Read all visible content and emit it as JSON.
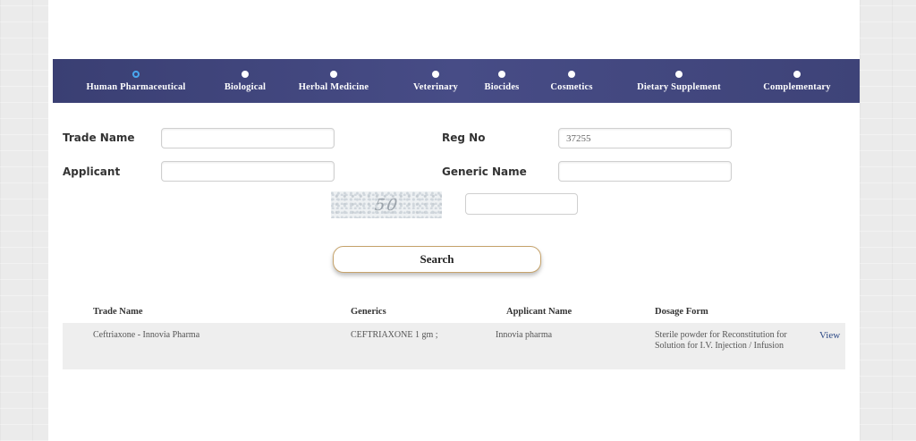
{
  "tabs": [
    {
      "label": "Human Pharmaceutical",
      "active": true
    },
    {
      "label": "Biological",
      "active": false
    },
    {
      "label": "Herbal Medicine",
      "active": false
    },
    {
      "label": "Veterinary",
      "active": false
    },
    {
      "label": "Biocides",
      "active": false
    },
    {
      "label": "Cosmetics",
      "active": false
    },
    {
      "label": "Dietary Supplement",
      "active": false
    },
    {
      "label": "Complementary",
      "active": false
    }
  ],
  "form": {
    "trade_name_label": "Trade Name",
    "trade_name_value": "",
    "reg_no_label": "Reg No",
    "reg_no_value": "37255",
    "applicant_label": "Applicant",
    "applicant_value": "",
    "generic_name_label": "Generic Name",
    "generic_name_value": "",
    "captcha_text": "50",
    "captcha_value": "",
    "search_label": "Search"
  },
  "results": {
    "headers": [
      "Trade Name",
      "Generics",
      "Applicant Name",
      "Dosage Form"
    ],
    "rows": [
      {
        "trade_name": "Ceftriaxone - Innovia Pharma",
        "generics": "CEFTRIAXONE 1 gm ;",
        "applicant": "Innovia pharma",
        "dosage_form": "Sterile powder for Reconstitution for Solution for I.V. Injection / Infusion",
        "action": "View"
      }
    ]
  },
  "colors": {
    "tabbar": "#41467e",
    "active_radio": "#49a8f0",
    "search_border": "#c6a36b"
  }
}
